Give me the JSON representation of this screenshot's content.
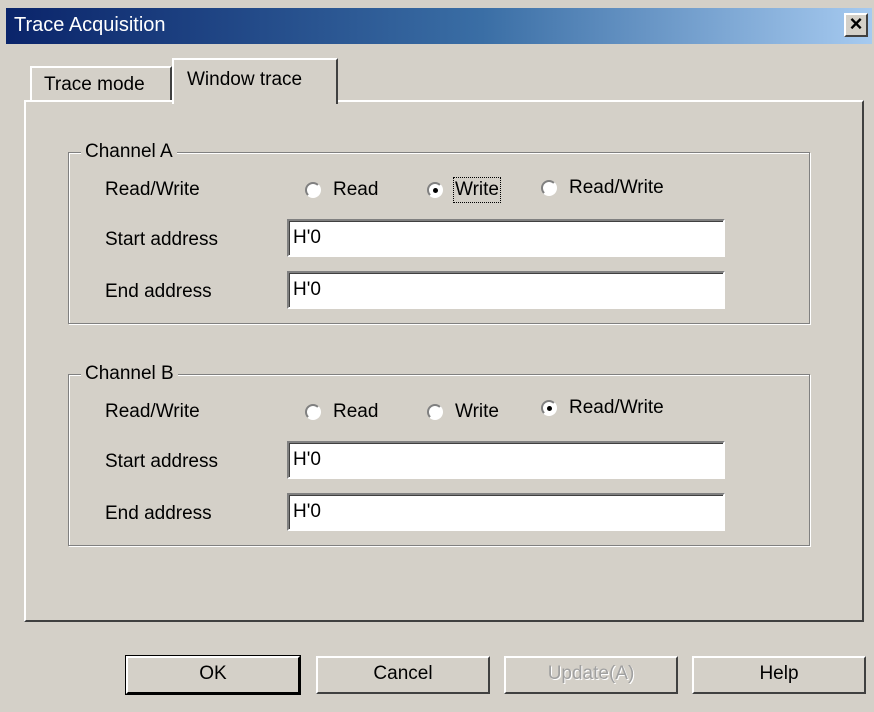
{
  "window": {
    "title": "Trace Acquisition",
    "close_glyph": "×"
  },
  "tabs": [
    {
      "label": "Trace mode",
      "active": false
    },
    {
      "label": "Window trace",
      "active": true
    }
  ],
  "channelA": {
    "legend": "Channel A",
    "rw_label": "Read/Write",
    "radios": [
      {
        "label": "Read",
        "checked": false
      },
      {
        "label": "Write",
        "checked": true
      },
      {
        "label": "Read/Write",
        "checked": false
      }
    ],
    "start_label": "Start address",
    "start_value": "H'0",
    "end_label": "End address",
    "end_value": "H'0"
  },
  "channelB": {
    "legend": "Channel B",
    "rw_label": "Read/Write",
    "radios": [
      {
        "label": "Read",
        "checked": false
      },
      {
        "label": "Write",
        "checked": false
      },
      {
        "label": "Read/Write",
        "checked": true
      }
    ],
    "start_label": "Start address",
    "start_value": "H'0",
    "end_label": "End address",
    "end_value": "H'0"
  },
  "buttons": {
    "ok": "OK",
    "cancel": "Cancel",
    "update": "Update(A)",
    "help": "Help"
  }
}
